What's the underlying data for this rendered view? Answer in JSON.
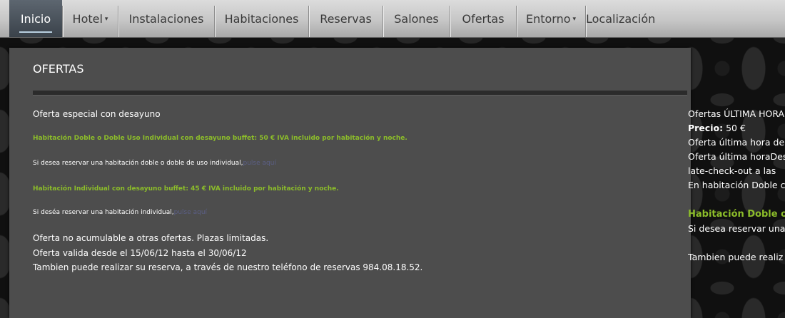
{
  "nav": {
    "items": [
      {
        "label": "Inicio",
        "active": true,
        "dropdown": false
      },
      {
        "label": "Hotel",
        "active": false,
        "dropdown": true
      },
      {
        "label": "Instalaciones",
        "active": false,
        "dropdown": false
      },
      {
        "label": "Habitaciones",
        "active": false,
        "dropdown": false
      },
      {
        "label": "Reservas",
        "active": false,
        "dropdown": false
      },
      {
        "label": "Salones",
        "active": false,
        "dropdown": false
      },
      {
        "label": "Ofertas",
        "active": false,
        "dropdown": false
      },
      {
        "label": "Entorno",
        "active": false,
        "dropdown": true
      },
      {
        "label": "Localización",
        "active": false,
        "dropdown": false
      }
    ],
    "dropdown_caret": "▾"
  },
  "main": {
    "title": "OFERTAS",
    "subtitle": "Oferta especial con desayuno",
    "offer_double": "Habitación Doble o Doble Uso Individual con desayuno buffet: 50 € IVA incluido por habitación y noche.",
    "reserve_double": "Si desea reservar una habitación doble o doble de uso individual,",
    "reserve_double_link": "pulse aquí",
    "offer_single": "Habitación Individual con desayuno buffet: 45 € IVA incluido por habitación y noche.",
    "reserve_single": "Si deséa reservar una habitación individual,",
    "reserve_single_link": "pulse aquí",
    "note1": "Oferta no acumulable a otras ofertas. Plazas limitadas.",
    "note2": "Oferta valida desde el 15/06/12 hasta el 30/06/12",
    "note3": "Tambien puede realizar su reserva, a través de nuestro teléfono de reservas 984.08.18.52."
  },
  "sidebar": {
    "line1": "Ofertas ÚLTIMA HORA",
    "price_label": "Precio:",
    "price_value": "50 €",
    "line3": "Oferta última hora de",
    "line4": "Oferta última horaDes",
    "line5": "late-check-out a las",
    "line6": "En habitación Doble c",
    "offer": "Habitación Doble o",
    "reserve": "Si desea reservar una",
    "phone": "Tambien puede realiz"
  },
  "colors": {
    "accent_green": "#8cbd2a",
    "panel_bg": "#4d4d4d",
    "link": "#5b5f85"
  }
}
